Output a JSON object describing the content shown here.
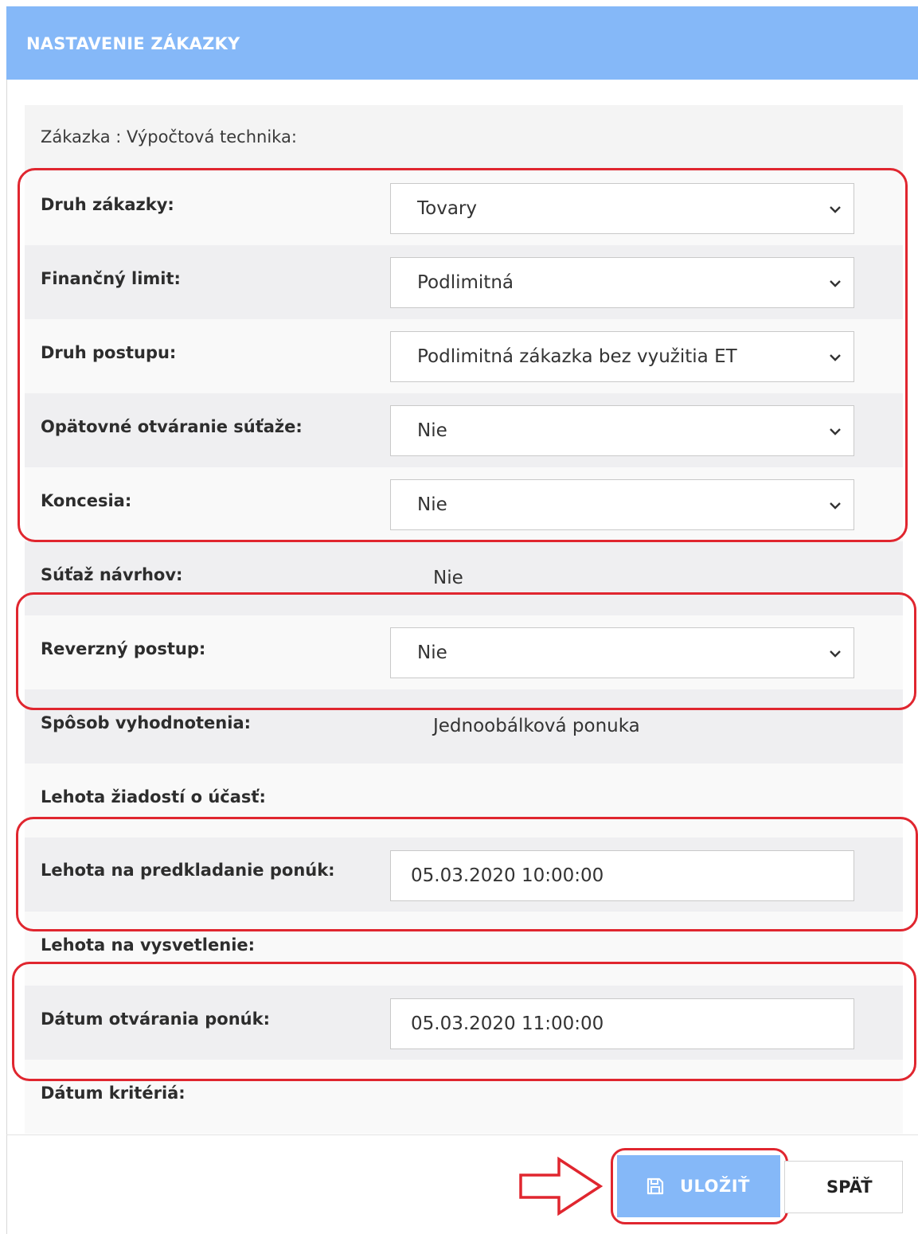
{
  "header": {
    "title": "NASTAVENIE ZÁKAZKY"
  },
  "subject": {
    "text": "Zákazka : Výpočtová technika:"
  },
  "fields": {
    "contract_type": {
      "label": "Druh zákazky:",
      "value": "Tovary"
    },
    "financial_limit": {
      "label": "Finančný limit:",
      "value": "Podlimitná"
    },
    "procedure_type": {
      "label": "Druh postupu:",
      "value": "Podlimitná zákazka bez využitia ET"
    },
    "reopening": {
      "label": "Opätovné otváranie súťaže:",
      "value": "Nie"
    },
    "concession": {
      "label": "Koncesia:",
      "value": "Nie"
    },
    "design_contest": {
      "label": "Súťaž návrhov:",
      "value": "Nie"
    },
    "reverse_procedure": {
      "label": "Reverzný postup:",
      "value": "Nie"
    },
    "evaluation_method": {
      "label": "Spôsob vyhodnotenia:",
      "value": "Jednoobálková ponuka"
    },
    "participation_deadline": {
      "label": "Lehota žiadostí o účasť:"
    },
    "bid_deadline": {
      "label": "Lehota na predkladanie ponúk:",
      "value": "05.03.2020 10:00:00"
    },
    "clarification_deadline": {
      "label": "Lehota na vysvetlenie:"
    },
    "opening_date": {
      "label": "Dátum otvárania ponúk:",
      "value": "05.03.2020 11:00:00"
    },
    "criteria_date": {
      "label": "Dátum kritériá:"
    }
  },
  "actions": {
    "save_label": "ULOŽIŤ",
    "back_label": "SPÄŤ"
  },
  "colors": {
    "header": "#85b8f8",
    "highlight": "#e0262f",
    "save_button": "#85b8f8"
  },
  "icons": {
    "dropdown": "chevron-down-icon",
    "save": "floppy-disk-icon",
    "pointer": "right-arrow-outline-icon"
  }
}
